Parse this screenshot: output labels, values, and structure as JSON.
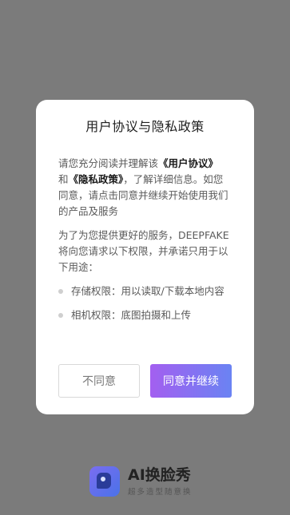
{
  "dialog": {
    "title": "用户协议与隐私政策",
    "intro": {
      "prefix": "请您充分阅读并理解该",
      "user_agreement": "《用户协议》",
      "conjunction": "和",
      "privacy_policy": "《隐私政策》",
      "suffix": "，了解详细信息。如您同意，请点击同意并继续开始使用我们的产品及服务"
    },
    "purpose_text": "为了为您提供更好的服务，DEEPFAKE将向您请求以下权限，并承诺只用于以下用途：",
    "permissions": [
      {
        "text": "存储权限：用以读取/下载本地内容"
      },
      {
        "text": "相机权限：底图拍摄和上传"
      }
    ],
    "buttons": {
      "disagree": "不同意",
      "agree": "同意并继续"
    }
  },
  "brand": {
    "name": "AI换脸秀",
    "slogan": "超多造型随意换"
  },
  "colors": {
    "overlay": "#7b7b7b",
    "agree_gradient_start": "#a35ff0",
    "agree_gradient_end": "#6a83f3"
  }
}
